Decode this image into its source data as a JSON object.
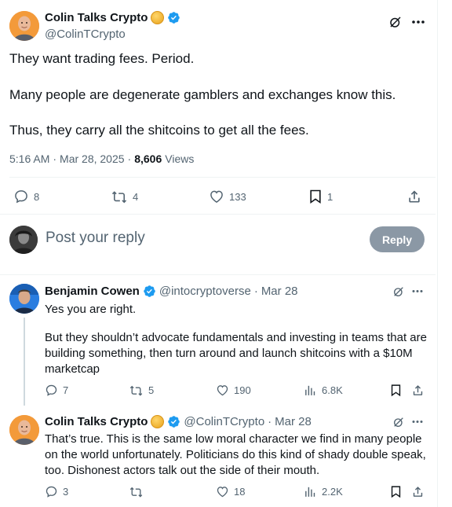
{
  "main_post": {
    "author_name": "Colin Talks Crypto",
    "author_handle": "@ColinTCrypto",
    "text_lines": [
      "They want trading fees. Period.",
      "Many people are degenerate gamblers and exchanges know this.",
      "Thus, they carry all the shitcoins to get all the fees."
    ],
    "time": "5:16 AM",
    "date": "Mar 28, 2025",
    "separator": "·",
    "views_count": "8,606",
    "views_label": "Views",
    "replies": "8",
    "reposts": "4",
    "likes": "133",
    "bookmarks": "1"
  },
  "composer": {
    "placeholder": "Post your reply",
    "button_label": "Reply"
  },
  "replies": [
    {
      "author_name": "Benjamin Cowen",
      "author_handle": "@intocryptoverse",
      "date": "Mar 28",
      "separator": "·",
      "paragraphs": [
        "Yes you are right.",
        "But they shouldn’t advocate fundamentals and investing in teams that are building something, then turn around and launch shitcoins with a $10M marketcap"
      ],
      "replies": "7",
      "reposts": "5",
      "likes": "190",
      "views": "6.8K"
    },
    {
      "author_name": "Colin Talks Crypto",
      "author_handle": "@ColinTCrypto",
      "date": "Mar 28",
      "separator": "·",
      "paragraphs": [
        "That’s true. This is the same low moral character we find in many people on the world unfortunately. Politicians do this kind of shady double speak, too. Dishonest actors talk out the side of their mouth."
      ],
      "replies": "3",
      "reposts": "",
      "likes": "18",
      "views": "2.2K"
    }
  ],
  "colors": {
    "text": "#0f1419",
    "muted": "#536471",
    "verified": "#1d9bf0",
    "reply_button_bg": "#8b98a5",
    "divider": "#eff3f4"
  }
}
